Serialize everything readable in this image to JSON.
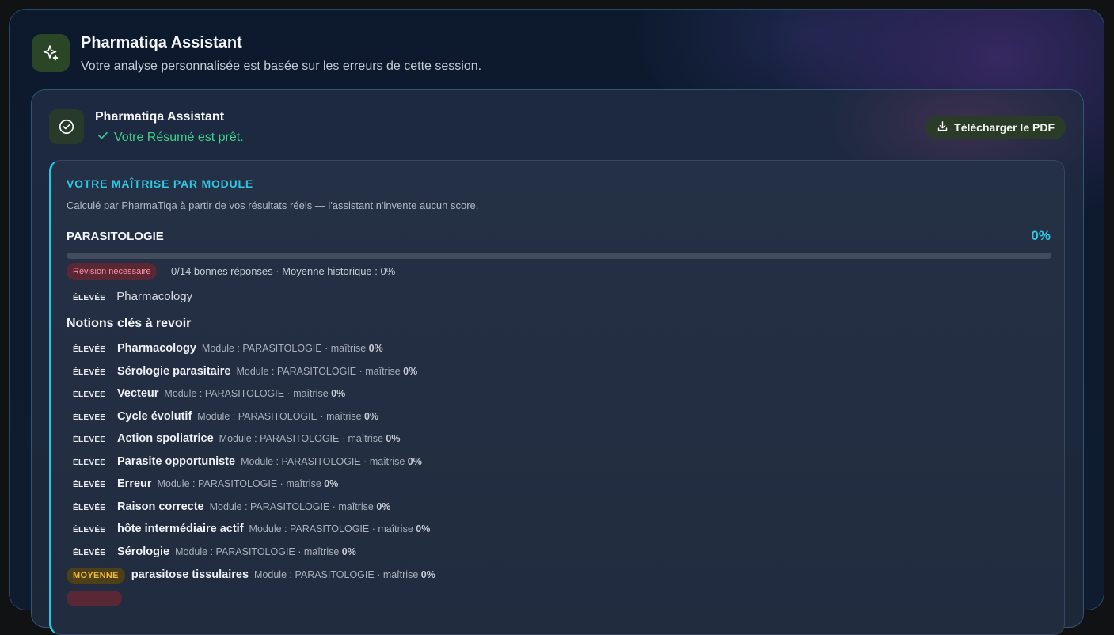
{
  "header": {
    "title": "Pharmatiqa Assistant",
    "subtitle": "Votre analyse personnalisée est basée sur les erreurs de cette session.",
    "icon": "sparkle-icon"
  },
  "card": {
    "title": "Pharmatiqa Assistant",
    "status": "Votre Résumé est prêt.",
    "status_icon": "check-icon",
    "pdf_button": "Télécharger le PDF",
    "pdf_icon": "download-icon"
  },
  "mastery": {
    "title": "VOTRE MAÎTRISE PAR MODULE",
    "subtitle": "Calculé par PharmaTiqa à partir de vos résultats réels — l'assistant n'invente aucun score.",
    "module": {
      "name": "PARASITOLOGIE",
      "percent_label": "0%",
      "percent": 0,
      "badge": "Révision nécessaire",
      "info": "0/14 bonnes réponses · Moyenne historique : 0%",
      "top_level": "ÉLEVÉE",
      "top_label": "Pharmacology"
    },
    "notions_title": "Notions clés à revoir",
    "notions": [
      {
        "level": "ÉLEVÉE",
        "name": "Pharmacology",
        "meta": "Module : PARASITOLOGIE · maîtrise ",
        "pct": "0%"
      },
      {
        "level": "ÉLEVÉE",
        "name": "Sérologie parasitaire",
        "meta": "Module : PARASITOLOGIE · maîtrise ",
        "pct": "0%"
      },
      {
        "level": "ÉLEVÉE",
        "name": "Vecteur",
        "meta": "Module : PARASITOLOGIE · maîtrise ",
        "pct": "0%"
      },
      {
        "level": "ÉLEVÉE",
        "name": "Cycle évolutif",
        "meta": "Module : PARASITOLOGIE · maîtrise ",
        "pct": "0%"
      },
      {
        "level": "ÉLEVÉE",
        "name": "Action spoliatrice",
        "meta": "Module : PARASITOLOGIE · maîtrise ",
        "pct": "0%"
      },
      {
        "level": "ÉLEVÉE",
        "name": "Parasite opportuniste",
        "meta": "Module : PARASITOLOGIE · maîtrise ",
        "pct": "0%"
      },
      {
        "level": "ÉLEVÉE",
        "name": "Erreur",
        "meta": "Module : PARASITOLOGIE · maîtrise ",
        "pct": "0%"
      },
      {
        "level": "ÉLEVÉE",
        "name": "Raison correcte",
        "meta": "Module : PARASITOLOGIE · maîtrise ",
        "pct": "0%"
      },
      {
        "level": "ÉLEVÉE",
        "name": "hôte intermédiaire actif",
        "meta": "Module : PARASITOLOGIE · maîtrise ",
        "pct": "0%"
      },
      {
        "level": "ÉLEVÉE",
        "name": "Sérologie",
        "meta": "Module : PARASITOLOGIE · maîtrise ",
        "pct": "0%"
      },
      {
        "level": "MOYENNE",
        "name": "parasitose tissulaires",
        "meta": "Module : PARASITOLOGIE · maîtrise ",
        "pct": "0%"
      }
    ]
  },
  "colors": {
    "accent_cyan": "#2cc8e4",
    "success_green": "#3ecf8e",
    "danger_badge": "#ff8fa3",
    "medium_badge": "#f0b93a"
  }
}
